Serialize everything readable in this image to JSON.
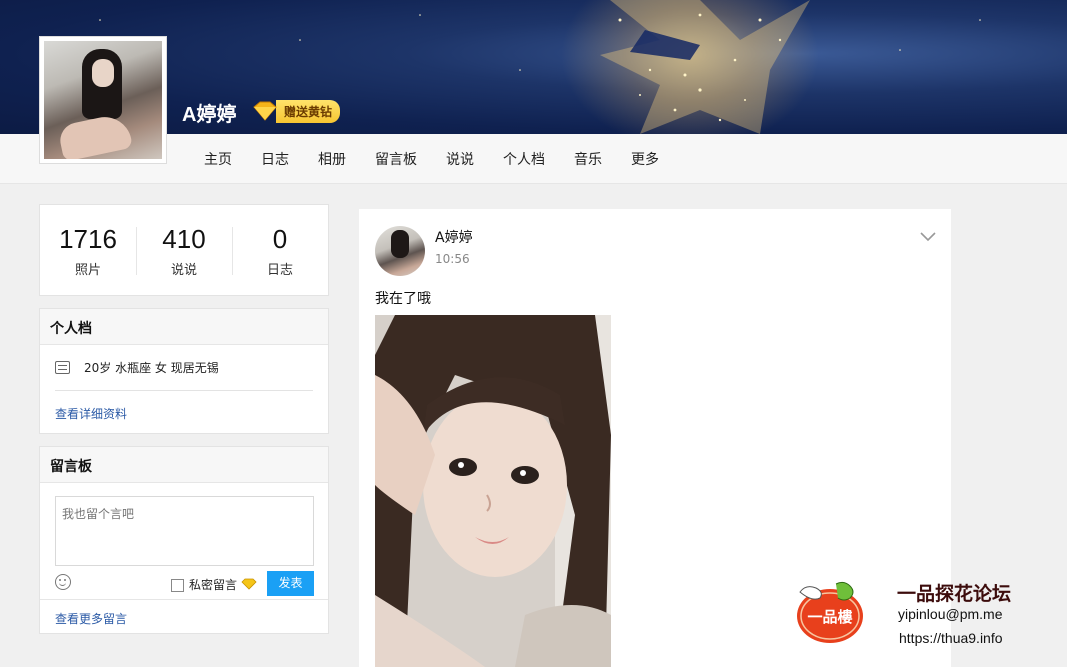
{
  "profile_header": {
    "username": "A婷婷",
    "vip_badge": "赠送黄钻"
  },
  "nav": {
    "items": [
      "主页",
      "日志",
      "相册",
      "留言板",
      "说说",
      "个人档",
      "音乐",
      "更多"
    ]
  },
  "stats": [
    {
      "value": "1716",
      "label": "照片"
    },
    {
      "value": "410",
      "label": "说说"
    },
    {
      "value": "0",
      "label": "日志"
    }
  ],
  "profile_card": {
    "title": "个人档",
    "info": "20岁  水瓶座 女 现居无锡",
    "more_link": "查看详细资料"
  },
  "guestbook": {
    "title": "留言板",
    "placeholder": "我也留个言吧",
    "private_label": "私密留言",
    "post_button": "发表",
    "more_link": "查看更多留言"
  },
  "feed_post": {
    "author": "A婷婷",
    "time": "10:56",
    "text": "我在了哦"
  },
  "watermark": {
    "title": "一品探花论坛",
    "email": "yipinlou@pm.me",
    "url": "https://thua9.info",
    "logo_text": "一品樓"
  },
  "colors": {
    "banner": "#0f2150",
    "post_button": "#1aa0f5",
    "link": "#2b5aa6",
    "vip_gold": "#f7c531"
  }
}
